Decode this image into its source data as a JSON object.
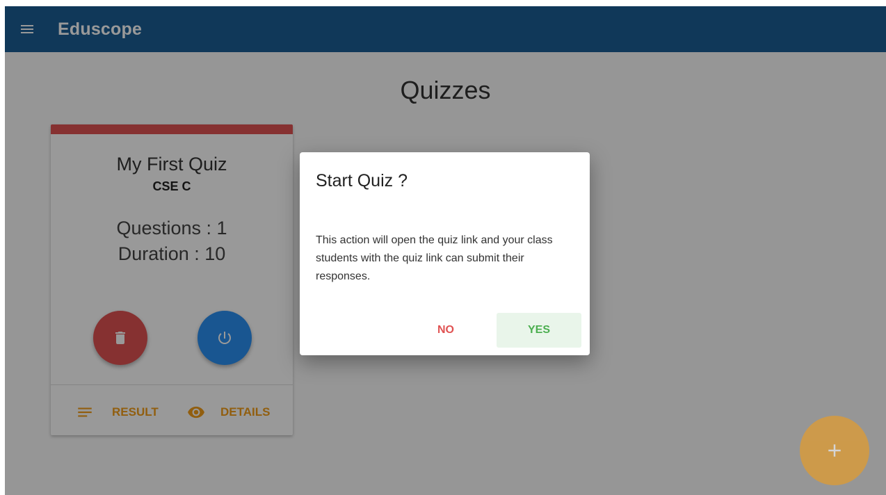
{
  "appbar": {
    "title": "Eduscope",
    "menu_icon": "menu-icon"
  },
  "page": {
    "title": "Quizzes"
  },
  "quiz_card": {
    "accent_color": "#e05252",
    "title": "My First Quiz",
    "class_name": "CSE C",
    "questions_text": "Questions : 1",
    "duration_text": "Duration : 10",
    "actions": {
      "delete_icon": "delete-icon",
      "start_icon": "power-icon"
    },
    "footer": {
      "result_label": "RESULT",
      "details_label": "DETAILS"
    }
  },
  "add_button": {
    "icon": "plus-icon"
  },
  "dialog": {
    "title": "Start Quiz ?",
    "text": "This action will open the quiz link and your class students with the quiz link can submit their responses.",
    "no_label": "NO",
    "yes_label": "YES"
  },
  "colors": {
    "appbar": "#1b5e94",
    "accent": "#f29d19",
    "danger": "#e05252",
    "primary": "#2a8ff2",
    "success": "#4caf50"
  }
}
